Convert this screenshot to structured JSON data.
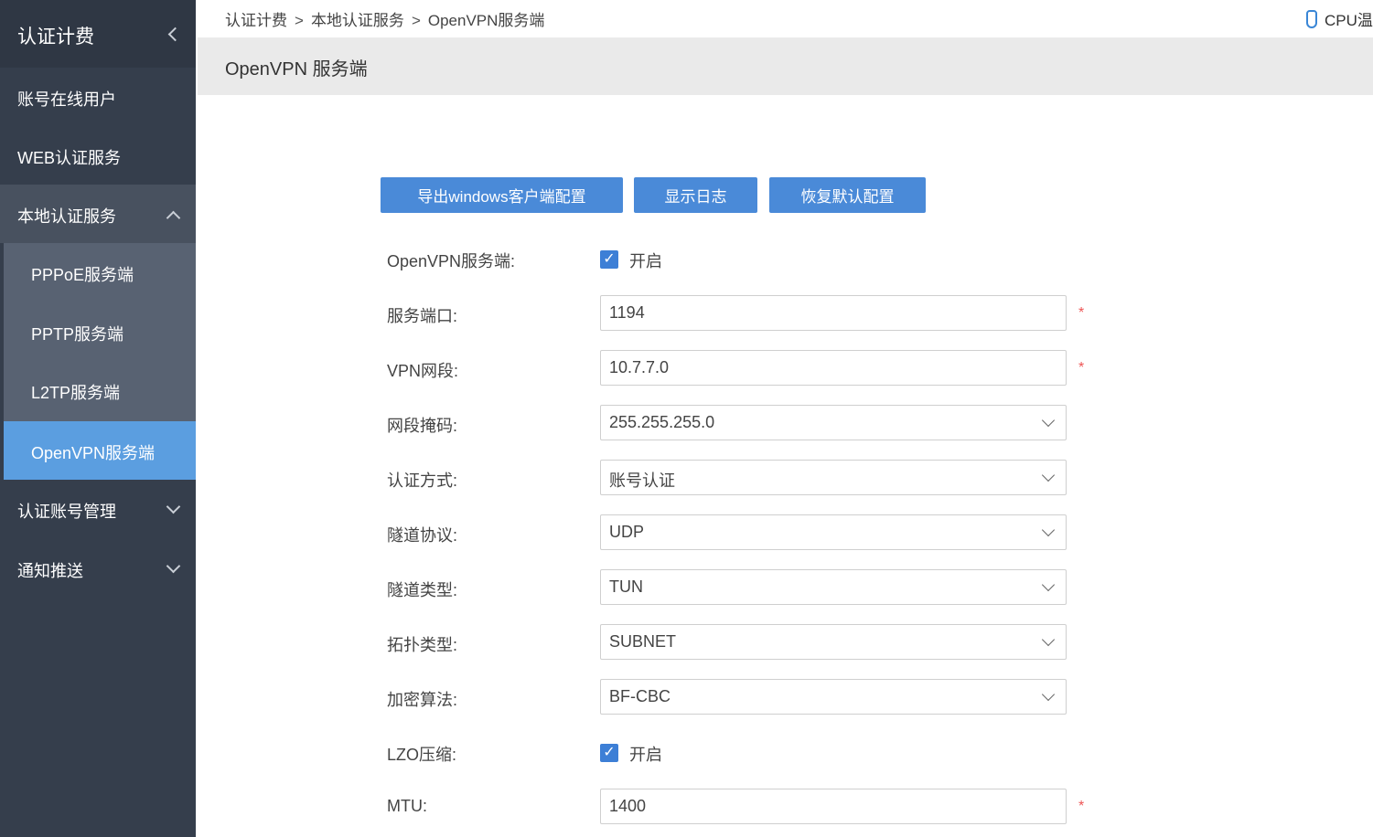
{
  "sidebar": {
    "title": "认证计费",
    "items": [
      {
        "label": "账号在线用户"
      },
      {
        "label": "WEB认证服务"
      },
      {
        "label": "本地认证服务"
      },
      {
        "label": "认证账号管理"
      },
      {
        "label": "通知推送"
      }
    ],
    "sub_items": [
      {
        "label": "PPPoE服务端"
      },
      {
        "label": "PPTP服务端"
      },
      {
        "label": "L2TP服务端"
      },
      {
        "label": "OpenVPN服务端"
      }
    ]
  },
  "breadcrumb": [
    "认证计费",
    "本地认证服务",
    "OpenVPN服务端"
  ],
  "breadcrumb_sep": ">",
  "cpu_label": "CPU温",
  "page_title": "OpenVPN 服务端",
  "buttons": {
    "export": "导出windows客户端配置",
    "log": "显示日志",
    "reset": "恢复默认配置"
  },
  "form": {
    "enable_label": "OpenVPN服务端:",
    "enable_text": "开启",
    "port_label": "服务端口:",
    "port_value": "1194",
    "segment_label": "VPN网段:",
    "segment_value": "10.7.7.0",
    "mask_label": "网段掩码:",
    "mask_value": "255.255.255.0",
    "auth_label": "认证方式:",
    "auth_value": "账号认证",
    "protocol_label": "隧道协议:",
    "protocol_value": "UDP",
    "tunnel_type_label": "隧道类型:",
    "tunnel_type_value": "TUN",
    "topology_label": "拓扑类型:",
    "topology_value": "SUBNET",
    "cipher_label": "加密算法:",
    "cipher_value": "BF-CBC",
    "lzo_label": "LZO压缩:",
    "lzo_text": "开启",
    "mtu_label": "MTU:",
    "mtu_value": "1400",
    "required_mark": "*",
    "check_mark": "✓"
  }
}
